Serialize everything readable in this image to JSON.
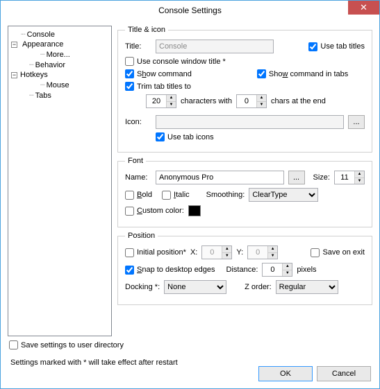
{
  "window": {
    "title": "Console Settings"
  },
  "tree": {
    "console": "Console",
    "appearance": "Appearance",
    "more": "More...",
    "behavior": "Behavior",
    "hotkeys": "Hotkeys",
    "mouse": "Mouse",
    "tabs": "Tabs"
  },
  "titleIcon": {
    "legend": "Title & icon",
    "titleLabel": "Title:",
    "titleValue": "Console",
    "useTabTitles": "Use tab titles",
    "useConsoleWindowTitle": "Use console window title *",
    "showCommand_pre": "S",
    "showCommand_u": "h",
    "showCommand_post": "ow command",
    "showCommandInTabs_pre": "Sho",
    "showCommandInTabs_u": "w",
    "showCommandInTabs_post": " command in tabs",
    "trimTabTitles": "Trim tab titles to",
    "trimValue": "20",
    "charsWith": "characters with",
    "endValue": "0",
    "charsAtEnd": "chars at the end",
    "iconLabel": "Icon:",
    "iconValue": "",
    "useTabIcons": "Use tab icons"
  },
  "font": {
    "legend": "Font",
    "nameLabel": "Name:",
    "nameValue": "Anonymous Pro",
    "sizeLabel": "Size:",
    "sizeValue": "11",
    "bold_u": "B",
    "bold_post": "old",
    "italic_u": "I",
    "italic_post": "talic",
    "smoothingLabel": "Smoothing:",
    "smoothingValue": "ClearType",
    "customColor_u": "C",
    "customColor_post": "ustom color:"
  },
  "position": {
    "legend": "Position",
    "initialPosition": "Initial position*",
    "xLabel": "X:",
    "xValue": "0",
    "yLabel": "Y:",
    "yValue": "0",
    "saveOnExit": "Save on exit",
    "snap_u": "S",
    "snap_post": "nap to desktop edges",
    "distanceLabel": "Distance:",
    "distanceValue": "0",
    "pixels": "pixels",
    "dockingLabel": "Docking *:",
    "dockingValue": "None",
    "zorderLabel": "Z order:",
    "zorderValue": "Regular"
  },
  "bottom": {
    "saveToUserDir": "Save settings to user directory",
    "note": "Settings marked with * will take effect after restart",
    "ok": "OK",
    "cancel": "Cancel"
  }
}
